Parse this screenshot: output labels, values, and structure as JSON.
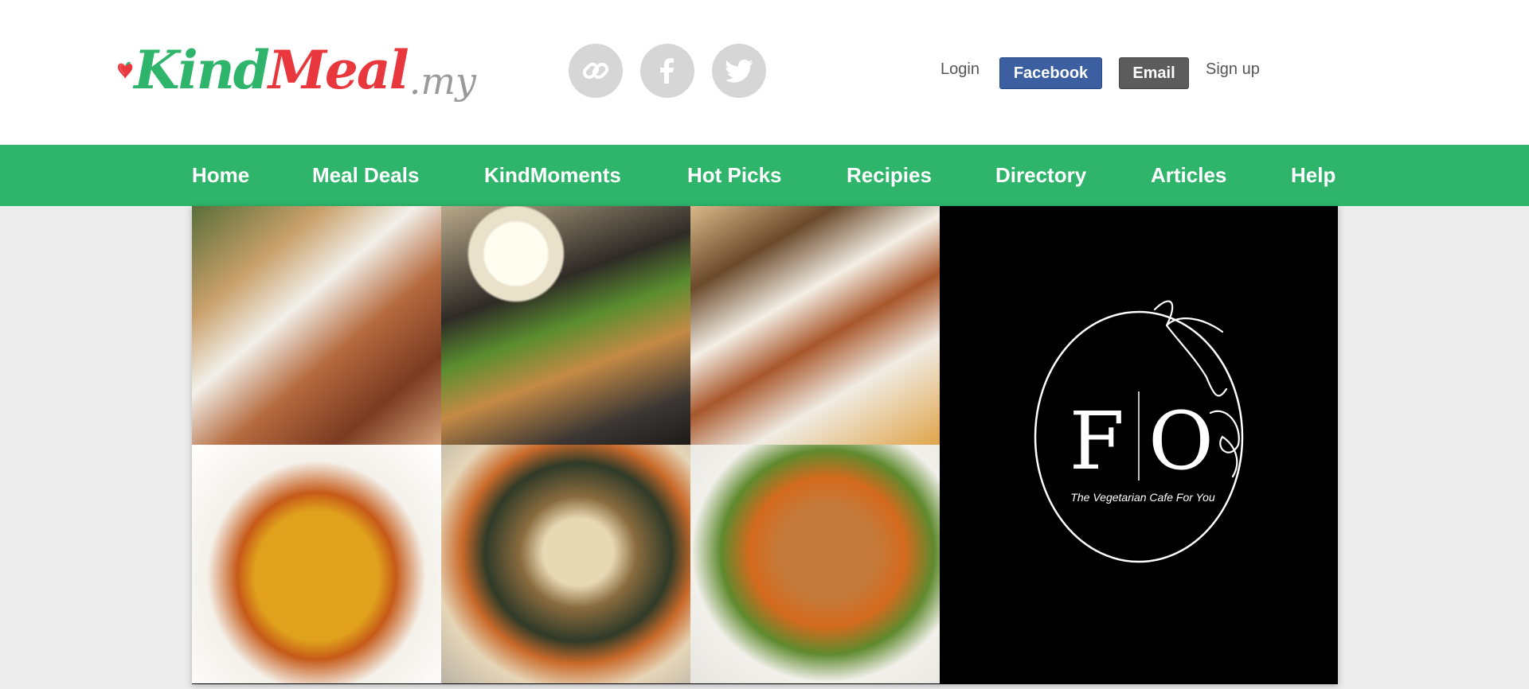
{
  "header": {
    "logo": {
      "kind": "Kind",
      "meal": "Meal",
      "tld": ".my"
    },
    "social": [
      {
        "name": "link",
        "icon": "link-icon"
      },
      {
        "name": "facebook",
        "icon": "facebook-icon"
      },
      {
        "name": "twitter",
        "icon": "twitter-icon"
      }
    ],
    "auth": {
      "login": "Login",
      "facebook": "Facebook",
      "email": "Email",
      "signup": "Sign up"
    }
  },
  "nav": {
    "items": [
      {
        "label": "Home"
      },
      {
        "label": "Meal Deals"
      },
      {
        "label": "KindMoments"
      },
      {
        "label": "Hot Picks"
      },
      {
        "label": "Recipies"
      },
      {
        "label": "Directory"
      },
      {
        "label": "Articles"
      },
      {
        "label": "Help"
      }
    ]
  },
  "gallery": {
    "tiles": [
      {
        "depicts": "vegetarian sushi roll platter"
      },
      {
        "depicts": "soup with toast and mushrooms"
      },
      {
        "depicts": "glazed sushi rolls"
      },
      {
        "depicts": "spaghetti with vegetables"
      },
      {
        "depicts": "assorted sushi bento"
      },
      {
        "depicts": "noodle soup with tofu"
      }
    ],
    "feature": {
      "monogram_left": "F",
      "monogram_right": "O",
      "tagline": "The Vegetarian Cafe For You"
    }
  },
  "colors": {
    "brand_green": "#2eb56b",
    "brand_red": "#e8383d",
    "facebook_blue": "#3b5fa0",
    "email_grey": "#5c5c5c",
    "page_bg": "#ececec"
  }
}
